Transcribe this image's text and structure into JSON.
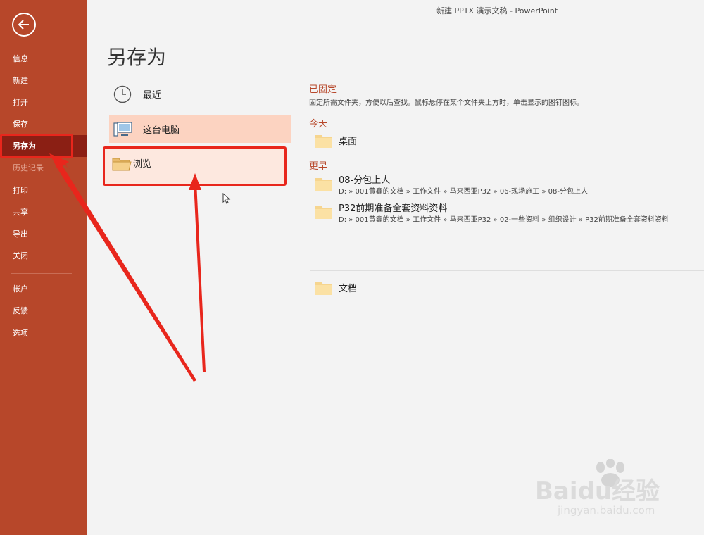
{
  "window": {
    "title": "新建 PPTX 演示文稿 - PowerPoint"
  },
  "sidebar": {
    "back_icon": "back-arrow-icon",
    "items": [
      {
        "label": "信息",
        "state": "normal"
      },
      {
        "label": "新建",
        "state": "normal"
      },
      {
        "label": "打开",
        "state": "normal"
      },
      {
        "label": "保存",
        "state": "normal"
      },
      {
        "label": "另存为",
        "state": "active"
      },
      {
        "label": "历史记录",
        "state": "disabled"
      },
      {
        "label": "打印",
        "state": "normal"
      },
      {
        "label": "共享",
        "state": "normal"
      },
      {
        "label": "导出",
        "state": "normal"
      },
      {
        "label": "关闭",
        "state": "normal"
      },
      {
        "label": "帐户",
        "state": "normal"
      },
      {
        "label": "反馈",
        "state": "normal"
      },
      {
        "label": "选项",
        "state": "normal"
      }
    ]
  },
  "page": {
    "title": "另存为"
  },
  "locations": [
    {
      "label": "最近",
      "icon": "clock-icon"
    },
    {
      "label": "这台电脑",
      "icon": "computer-icon"
    },
    {
      "label": "浏览",
      "icon": "folder-icon"
    }
  ],
  "pinned": {
    "heading": "已固定",
    "description": "固定所需文件夹，方便以后查找。鼠标悬停在某个文件夹上方时，单击显示的图钉图标。"
  },
  "today": {
    "heading": "今天",
    "folders": [
      {
        "name": "桌面"
      }
    ]
  },
  "earlier": {
    "heading": "更早",
    "folders": [
      {
        "name": "08-分包上人",
        "path": "D: » 001黄鑫的文档 » 工作文件 » 马来西亚P32 » 06-现场施工 » 08-分包上人"
      },
      {
        "name": "P32前期准备全套资料资料",
        "path": "D: » 001黄鑫的文档 » 工作文件 » 马来西亚P32 » 02-一些资料 » 组织设计 » P32前期准备全套资料资料"
      }
    ]
  },
  "other": {
    "folders": [
      {
        "name": "文档"
      }
    ]
  },
  "watermark": {
    "brand": "Baidu经验",
    "url": "jingyan.baidu.com"
  },
  "colors": {
    "accent": "#b7472a",
    "active_item": "#8b1f14",
    "annotation": "#e8261c",
    "selected": "#fcd3c1"
  }
}
